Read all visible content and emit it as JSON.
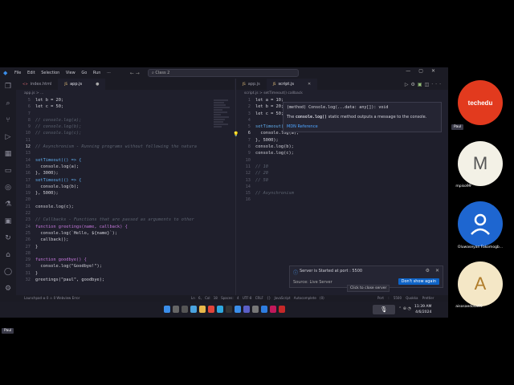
{
  "window": {
    "menu": [
      "File",
      "Edit",
      "Selection",
      "View",
      "Go",
      "Run"
    ],
    "search": "Class 2",
    "logo_icon": "vscode-icon"
  },
  "left_editor": {
    "tabs": [
      {
        "label": "index.html",
        "active": false
      },
      {
        "label": "app.js",
        "active": true
      }
    ],
    "breadcrumb": "app.js > ...",
    "lines": [
      {
        "n": "5",
        "t": "let b = 20;",
        "cls": "txt"
      },
      {
        "n": "6",
        "t": "let c = 50;",
        "cls": "txt"
      },
      {
        "n": "7",
        "t": "",
        "cls": "txt"
      },
      {
        "n": "8",
        "t": "// console.log(a);",
        "cls": "cm"
      },
      {
        "n": "9",
        "t": "// console.log(b);",
        "cls": "cm"
      },
      {
        "n": "10",
        "t": "// console.log(c);",
        "cls": "cm"
      },
      {
        "n": "11",
        "t": "",
        "cls": "txt"
      },
      {
        "n": "12",
        "t": "// Asynchronism - Running programs without following the natura",
        "cls": "cm"
      },
      {
        "n": "13",
        "t": "",
        "cls": "txt"
      },
      {
        "n": "14",
        "t": "setTimeout(() => {",
        "cls": "fn"
      },
      {
        "n": "15",
        "t": "  console.log(a);",
        "cls": "txt"
      },
      {
        "n": "16",
        "t": "}, 3000);",
        "cls": "txt"
      },
      {
        "n": "17",
        "t": "setTimeout(() => {",
        "cls": "fn"
      },
      {
        "n": "18",
        "t": "  console.log(b);",
        "cls": "txt"
      },
      {
        "n": "19",
        "t": "}, 5000);",
        "cls": "txt"
      },
      {
        "n": "20",
        "t": "",
        "cls": "txt"
      },
      {
        "n": "21",
        "t": "console.log(c);",
        "cls": "txt"
      },
      {
        "n": "22",
        "t": "",
        "cls": "txt"
      },
      {
        "n": "23",
        "t": "// Callbacks - Functions that are passed as arguments to other",
        "cls": "cm"
      },
      {
        "n": "24",
        "t": "function greetings(name, callback) {",
        "cls": "kw"
      },
      {
        "n": "25",
        "t": "  console.log(`Hello, ${name}`);",
        "cls": "txt"
      },
      {
        "n": "26",
        "t": "  callback();",
        "cls": "txt"
      },
      {
        "n": "27",
        "t": "}",
        "cls": "txt"
      },
      {
        "n": "28",
        "t": "",
        "cls": "txt"
      },
      {
        "n": "29",
        "t": "function goodbye() {",
        "cls": "kw"
      },
      {
        "n": "30",
        "t": "  console.log(\"Goodbye!\");",
        "cls": "txt"
      },
      {
        "n": "31",
        "t": "}",
        "cls": "txt"
      },
      {
        "n": "32",
        "t": "greetings(\"paul\", goodbye);",
        "cls": "txt"
      }
    ]
  },
  "right_editor": {
    "tabs": [
      {
        "label": "app.js",
        "active": false
      },
      {
        "label": "script.js",
        "active": true
      }
    ],
    "breadcrumb": "script.js > setTimeout() callback",
    "lines": [
      {
        "n": "1",
        "t": "let a = 10;",
        "cls": "txt"
      },
      {
        "n": "2",
        "t": "let b = 20;",
        "cls": "txt"
      },
      {
        "n": "3",
        "t": "let c = 50;",
        "cls": "txt"
      },
      {
        "n": "4",
        "t": "",
        "cls": "txt"
      },
      {
        "n": "5",
        "t": "setTimeout(() => {",
        "cls": "fn"
      },
      {
        "n": "6",
        "t": "  console.log(a);",
        "cls": "txt"
      },
      {
        "n": "7",
        "t": "}, 5000);",
        "cls": "txt"
      },
      {
        "n": "8",
        "t": "console.log(b);",
        "cls": "txt"
      },
      {
        "n": "9",
        "t": "console.log(c);",
        "cls": "txt"
      },
      {
        "n": "10",
        "t": "",
        "cls": "txt"
      },
      {
        "n": "11",
        "t": "// 10",
        "cls": "cm"
      },
      {
        "n": "12",
        "t": "// 20",
        "cls": "cm"
      },
      {
        "n": "13",
        "t": "// 50",
        "cls": "cm"
      },
      {
        "n": "14",
        "t": "",
        "cls": "txt"
      },
      {
        "n": "15",
        "t": "// Asynchronism",
        "cls": "cm"
      },
      {
        "n": "16",
        "t": "",
        "cls": "txt"
      }
    ]
  },
  "hover": {
    "signature": "(method) Console.log(...data: any[]): void",
    "desc_prefix": "The ",
    "desc_code": "console.log()",
    "desc_suffix": " static method outputs a message to the console.",
    "link": "MDN Reference"
  },
  "notification": {
    "message": "Server is Started at port : 5500",
    "source": "Source: Live Server",
    "button": "Don't show again",
    "tooltip": "Click to close server"
  },
  "statusbar": {
    "left": "Launchpad    ⊗ 0  ⚠ 0        Webview Error",
    "middle": "Ln 6, Col 18  Spaces: 4  UTF-8  CRLF  {} JavaScript  Autocomplete (0)",
    "right": "Port : 5500   Quokka   Prettier"
  },
  "taskbar": {
    "time": "11:39 AM",
    "date": "4/6/2024"
  },
  "participants": [
    {
      "name": "techedu",
      "label": "Paul"
    },
    {
      "name": "mpiso99",
      "initial": "M"
    },
    {
      "name": "Oluwaseyan Fakomogb...",
      "initial": ""
    },
    {
      "name": "aisosaedosa65",
      "initial": "A"
    }
  ],
  "bottom_tag": "Paul",
  "colors": {
    "editor_bg": "#1f1f2c",
    "accent": "#0e63c6",
    "techedu_red": "#e23a1e",
    "avatar_m": "#f3f1e6",
    "avatar_blue": "#1e66d0",
    "avatar_a": "#f4e7c6"
  }
}
